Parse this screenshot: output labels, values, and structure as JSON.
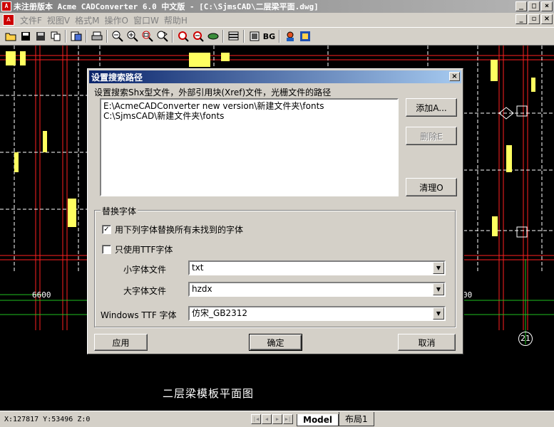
{
  "window": {
    "title": "未注册版本 Acme CADConverter 6.0 中文版 - [C:\\SjmsCAD\\二层梁平面.dwg]",
    "controls": [
      "_",
      "□",
      "×"
    ]
  },
  "menu": {
    "items": [
      "文件F",
      "视图V",
      "格式M",
      "操作O",
      "窗口W",
      "帮助H"
    ],
    "mdi_controls": [
      "_",
      "▫",
      "×"
    ]
  },
  "toolbar": {
    "bg_label": "BG"
  },
  "drawing": {
    "title": "二层梁模板平面图",
    "dim_left": "6600",
    "dim_right": "00",
    "axis_label": "21"
  },
  "dialog": {
    "title": "设置搜索路径",
    "description": "设置搜索Shx型文件，外部引用块(Xref)文件，光栅文件的路径",
    "paths": [
      "E:\\AcmeCADConverter new version\\新建文件夹\\fonts",
      "C:\\SjmsCAD\\新建文件夹\\fonts"
    ],
    "add_button": "添加A...",
    "delete_button": "删除E",
    "clear_button": "清理O",
    "group_label": "替换字体",
    "replace_check_label": "用下列字体替换所有未找到的字体",
    "replace_checked": true,
    "ttf_only_label": "只使用TTF字体",
    "ttf_only_checked": false,
    "small_font_label": "小字体文件",
    "small_font_value": "txt",
    "big_font_label": "大字体文件",
    "big_font_value": "hzdx",
    "ttf_font_label": "Windows TTF 字体",
    "ttf_font_value": "仿宋_GB2312",
    "apply_button": "应用",
    "ok_button": "确定",
    "cancel_button": "取消"
  },
  "status": {
    "coords": "X:127817 Y:53496 Z:0",
    "tabs": [
      "Model",
      "布局1"
    ],
    "active_tab": "Model"
  }
}
